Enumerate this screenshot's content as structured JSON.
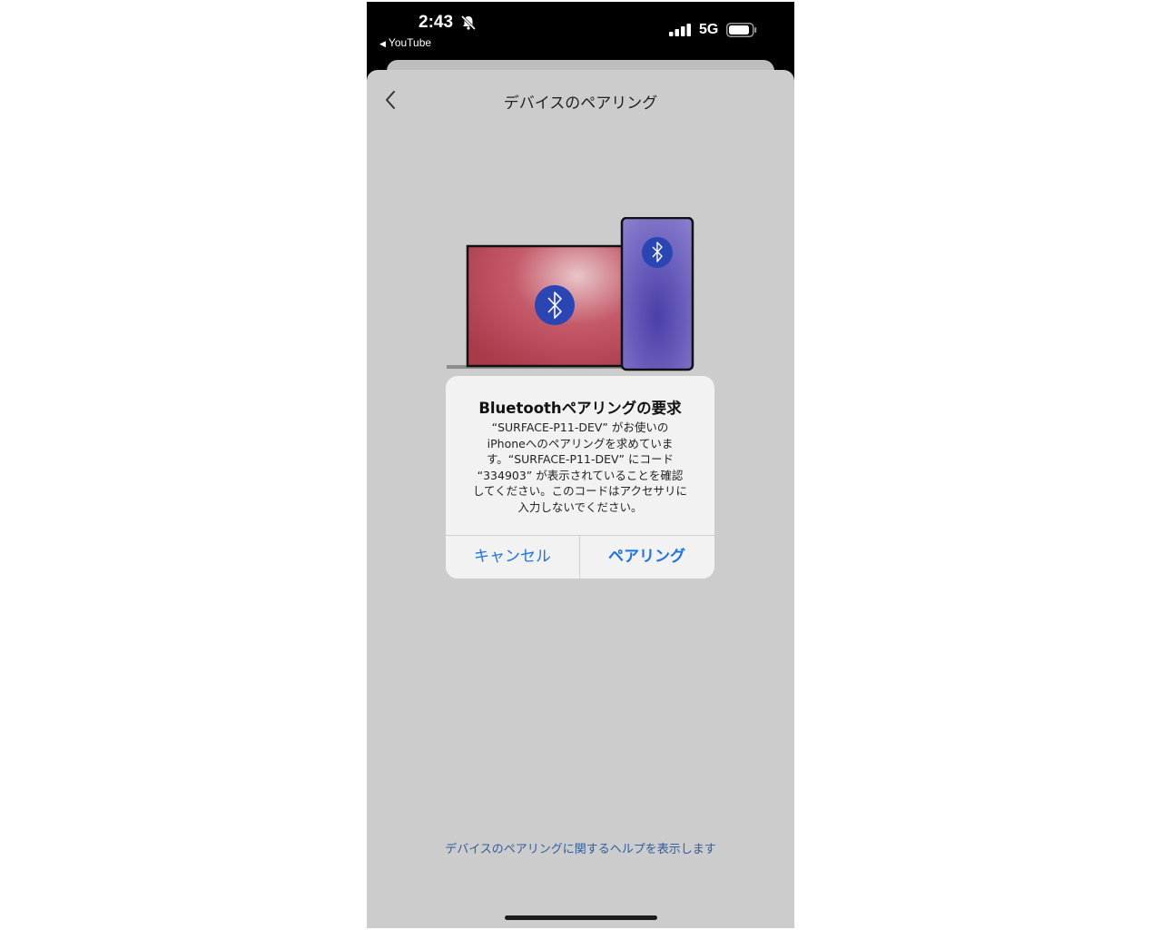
{
  "status_bar": {
    "time": "2:43",
    "back_app": "YouTube",
    "network": "5G",
    "icons": [
      "bell-slash-icon",
      "signal-icon",
      "battery-icon"
    ]
  },
  "nav": {
    "title": "デバイスのペアリング",
    "back_icon": "chevron-left-icon"
  },
  "illustration": {
    "icons": [
      "laptop-icon",
      "phone-icon",
      "bluetooth-icon"
    ]
  },
  "alert": {
    "title": "Bluetoothペアリングの要求",
    "message": "“SURFACE-P11-DEV” がお使いの\niPhoneへのペアリングを求めていま\nす。“SURFACE-P11-DEV” にコード\n“334903” が表示されていることを確認\nしてください。このコードはアクセサリに\n入力しないでください。",
    "cancel_label": "キャンセル",
    "pair_label": "ペアリング"
  },
  "footer": {
    "help_link": "デバイスのペアリングに関するヘルプを表示します"
  },
  "colors": {
    "accent": "#1a73e8",
    "sheet_background": "#cccccc",
    "alert_background": "#f2f2f2"
  }
}
